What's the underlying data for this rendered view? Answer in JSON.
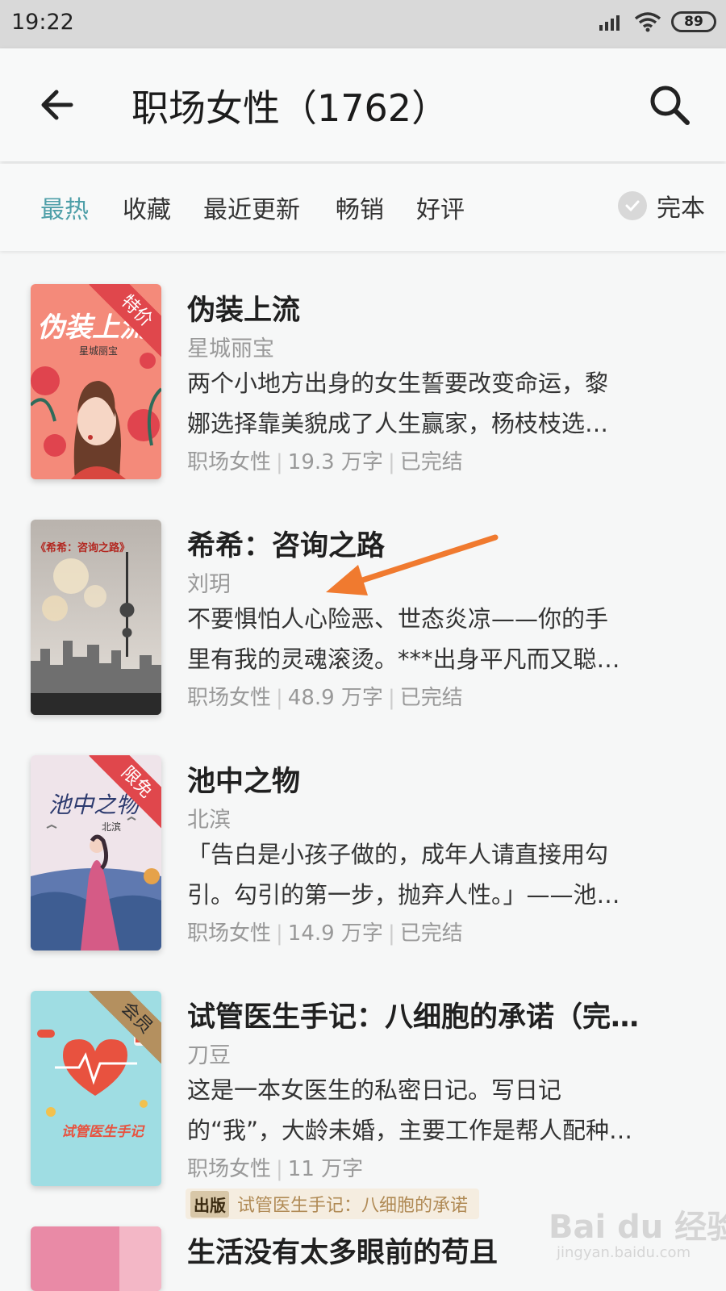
{
  "status_bar": {
    "time": "19:22",
    "battery": "89"
  },
  "header": {
    "title": "职场女性（1762）"
  },
  "filters": {
    "tabs": [
      {
        "label": "最热",
        "active": true
      },
      {
        "label": "收藏",
        "active": false
      },
      {
        "label": "最近更新",
        "active": false
      },
      {
        "label": "畅销",
        "active": false
      },
      {
        "label": "好评",
        "active": false
      }
    ],
    "finished_label": "完本"
  },
  "books": [
    {
      "title": "伪装上流",
      "author": "星城丽宝",
      "desc_line1": "两个小地方出身的女生誓要改变命运，黎",
      "desc_line2": "娜选择靠美貌成了人生赢家，杨枝枝选…",
      "category": "职场女性",
      "words": "19.3 万字",
      "status": "已完结",
      "ribbon": "特价",
      "cover_title": "伪装上流",
      "cover_author": "星城丽宝"
    },
    {
      "title": "希希：咨询之路",
      "author": "刘玥",
      "desc_line1": "不要惧怕人心险恶、世态炎凉——你的手",
      "desc_line2": "里有我的灵魂滚烫。***出身平凡而又聪…",
      "category": "职场女性",
      "words": "48.9 万字",
      "status": "已完结",
      "cover_title": "《希希：咨询之路》"
    },
    {
      "title": "池中之物",
      "author": "北滨",
      "desc_line1": "「告白是小孩子做的，成年人请直接用勾",
      "desc_line2": "引。勾引的第一步，抛弃人性。」——池…",
      "category": "职场女性",
      "words": "14.9 万字",
      "status": "已完结",
      "ribbon": "限免",
      "cover_title": "池中之物",
      "cover_author": "北滨"
    },
    {
      "title": "试管医生手记：八细胞的承诺（完…",
      "author": "刀豆",
      "desc_line1": "这是一本女医生的私密日记。写日记",
      "desc_line2": "的“我”，大龄未婚，主要工作是帮人配种…",
      "category": "职场女性",
      "words": "11 万字",
      "ribbon": "会员",
      "cover_title": "试管医生手记",
      "pub_badge": "出版",
      "pub_text": "试管医生手记：八细胞的承诺"
    },
    {
      "title": "生活没有太多眼前的苟且"
    }
  ],
  "watermark": {
    "brand": "Bai du 经验",
    "url": "jingyan.baidu.com"
  },
  "colors": {
    "accent": "#4e9fa8",
    "arrow": "#f07a2f",
    "ribbon_red": "#e0474c",
    "ribbon_tan": "#b4905f"
  }
}
